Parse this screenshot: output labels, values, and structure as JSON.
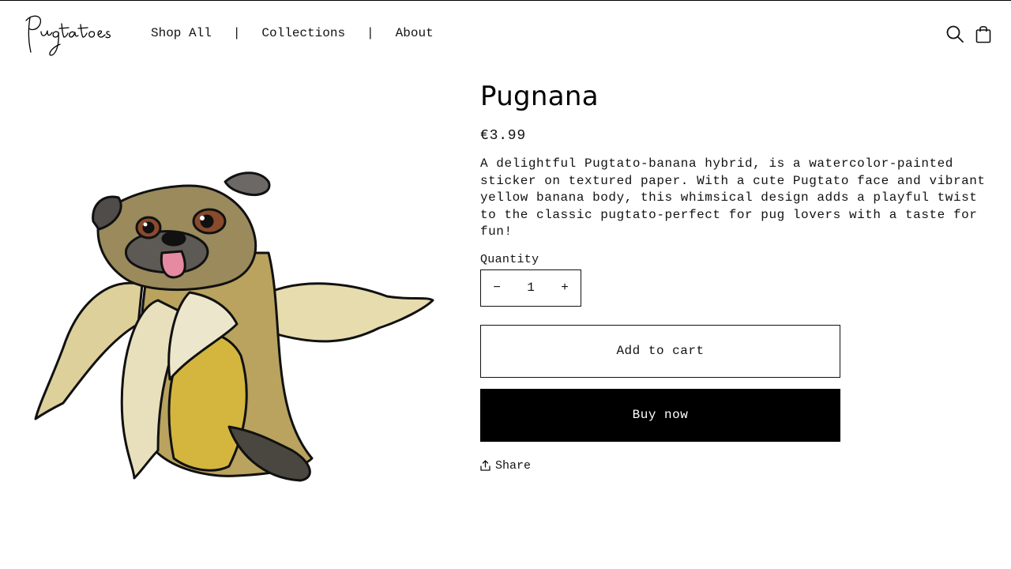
{
  "header": {
    "logo_text": "Pugtatoes",
    "nav": [
      {
        "label": "Shop All"
      },
      {
        "label": "Collections"
      },
      {
        "label": "About"
      }
    ],
    "nav_separator": "|",
    "icons": [
      "search-icon",
      "shopping-bag-icon"
    ]
  },
  "product": {
    "title": "Pugnana",
    "price": "€3.99",
    "description": "A delightful Pugtato-banana hybrid, is a watercolor-painted sticker on textured paper. With a cute Pugtato face and vibrant yellow banana body, this whimsical design adds a playful twist to the classic pugtato-perfect for pug lovers with a taste for fun!",
    "quantity": {
      "label": "Quantity",
      "value": "1",
      "minus": "−",
      "plus": "+"
    },
    "add_to_cart": "Add to cart",
    "buy_now": "Buy now",
    "share": "Share"
  },
  "colors": {
    "primary": "#000000",
    "text": "#121212",
    "background": "#ffffff"
  }
}
